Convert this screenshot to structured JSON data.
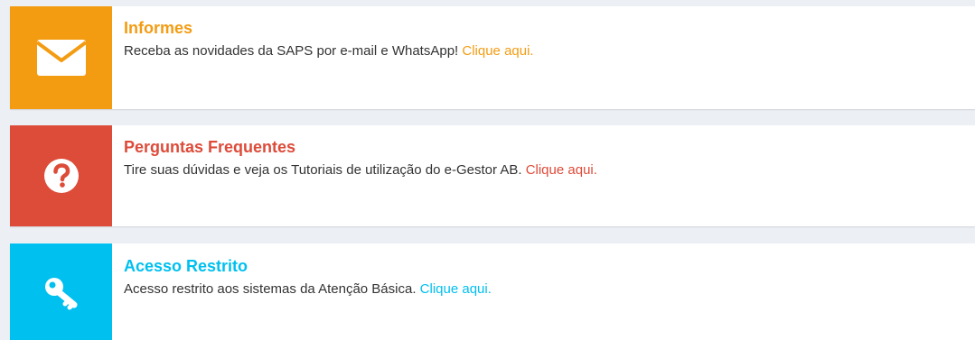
{
  "cards": [
    {
      "icon": "envelope-icon",
      "title": "Informes",
      "text": "Receba as novidades da SAPS por e-mail e WhatsApp!",
      "link": "Clique aqui.",
      "color": "#f39c12"
    },
    {
      "icon": "question-circle-icon",
      "title": "Perguntas Frequentes",
      "text": "Tire suas dúvidas e veja os Tutoriais de utilização do e-Gestor AB.",
      "link": "Clique aqui.",
      "color": "#dd4b39"
    },
    {
      "icon": "key-icon",
      "title": "Acesso Restrito",
      "text": "Acesso restrito aos sistemas da Atenção Básica.",
      "link": "Clique aqui.",
      "color": "#00c0ef"
    }
  ]
}
